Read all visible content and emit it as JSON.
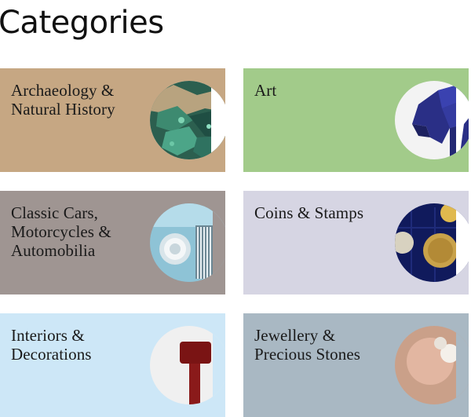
{
  "page": {
    "title": "Categories"
  },
  "categories": [
    {
      "lines": [
        "Archaeology &",
        "Natural History"
      ],
      "bg": "#c6a783",
      "icon": "mineral-crystal-icon"
    },
    {
      "lines": [
        "Art"
      ],
      "bg": "#a2cb8a",
      "icon": "sculpture-panther-icon"
    },
    {
      "lines": [
        "Classic Cars,",
        "Motorcycles &",
        "Automobilia"
      ],
      "bg": "#9f9592",
      "icon": "classic-car-headlight-icon"
    },
    {
      "lines": [
        "Coins & Stamps"
      ],
      "bg": "#d6d5e3",
      "icon": "gold-coins-icon"
    },
    {
      "lines": [
        "Interiors &",
        "Decorations"
      ],
      "bg": "#cde7f7",
      "icon": "lamp-decoration-icon"
    },
    {
      "lines": [
        "Jewellery &",
        "Precious Stones"
      ],
      "bg": "#a9b8c3",
      "icon": "jewellery-gems-icon"
    }
  ]
}
